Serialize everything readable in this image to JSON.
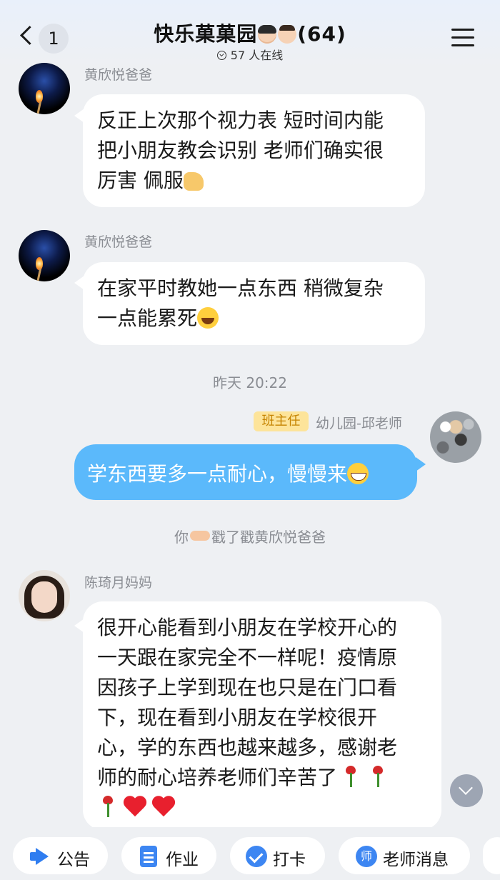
{
  "header": {
    "back_count": "1",
    "title_prefix": "快乐菓菓园",
    "title_suffix": "(64)",
    "online": "57 人在线"
  },
  "messages": {
    "m1": {
      "sender": "黄欣悦爸爸",
      "lines": [
        "反正上次那个视力表 短时间内能",
        "把小朋友教会识别 老师们确实很",
        "厉害 佩服"
      ]
    },
    "m2": {
      "sender": "黄欣悦爸爸",
      "lines": [
        "在家平时教她一点东西 稍微复杂",
        "一点能累死"
      ]
    },
    "timestamp": "昨天 20:22",
    "m3": {
      "badge": "班主任",
      "sender": "幼儿园-邱老师",
      "text": "学东西要多一点耐心，慢慢来"
    },
    "poke": {
      "left": "你",
      "right": "戳了戳黄欣悦爸爸"
    },
    "m4": {
      "sender": "陈琦月妈妈",
      "lines": [
        "很开心能看到小朋友在学校开心的",
        "一天跟在家完全不一样呢！疫情原",
        "因孩子上学到现在也只是在门口看",
        "下，现在看到小朋友在学校很开",
        "心，学的东西也越来越多，感谢老",
        "师的耐心培养老师们辛苦了"
      ]
    }
  },
  "bottom_bar": {
    "announcement": "公告",
    "homework": "作业",
    "checkin": "打卡",
    "teacher_msg": "老师消息",
    "teacher_icon_char": "师"
  },
  "icons": [
    "back-icon",
    "menu-icon",
    "check-circle-icon",
    "megaphone-icon",
    "document-icon",
    "check-icon",
    "teacher-icon",
    "chevron-down-icon"
  ],
  "colors": {
    "my_bubble": "#5bb9fb",
    "badge_bg": "#fde49a",
    "badge_text": "#c58300",
    "accent": "#3d86f2"
  }
}
